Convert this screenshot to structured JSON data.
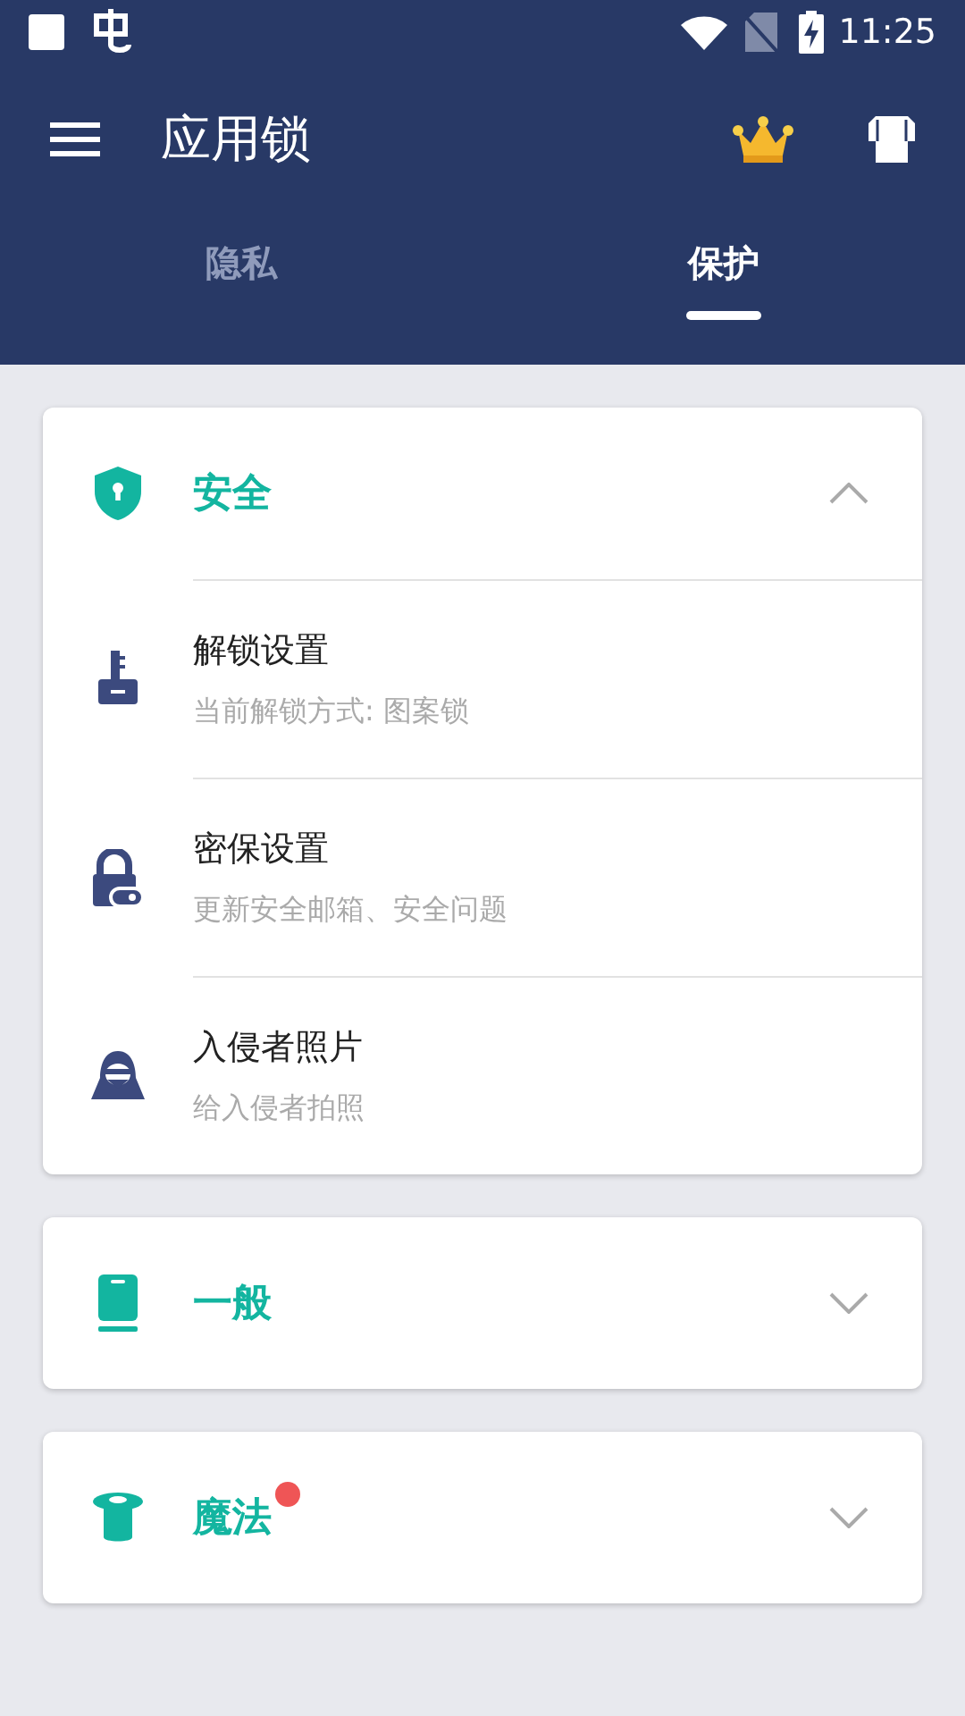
{
  "status_bar": {
    "time": "11:25"
  },
  "toolbar": {
    "title": "应用锁"
  },
  "tabs": [
    {
      "label": "隐私",
      "selected": false
    },
    {
      "label": "保护",
      "selected": true
    }
  ],
  "sections": [
    {
      "title": "安全",
      "expanded": true,
      "badge": false,
      "items": [
        {
          "title": "解锁设置",
          "subtitle": "当前解锁方式: 图案锁"
        },
        {
          "title": "密保设置",
          "subtitle": "更新安全邮箱、安全问题"
        },
        {
          "title": "入侵者照片",
          "subtitle": "给入侵者拍照"
        }
      ]
    },
    {
      "title": "一般",
      "expanded": false,
      "badge": false
    },
    {
      "title": "魔法",
      "expanded": false,
      "badge": true
    }
  ]
}
